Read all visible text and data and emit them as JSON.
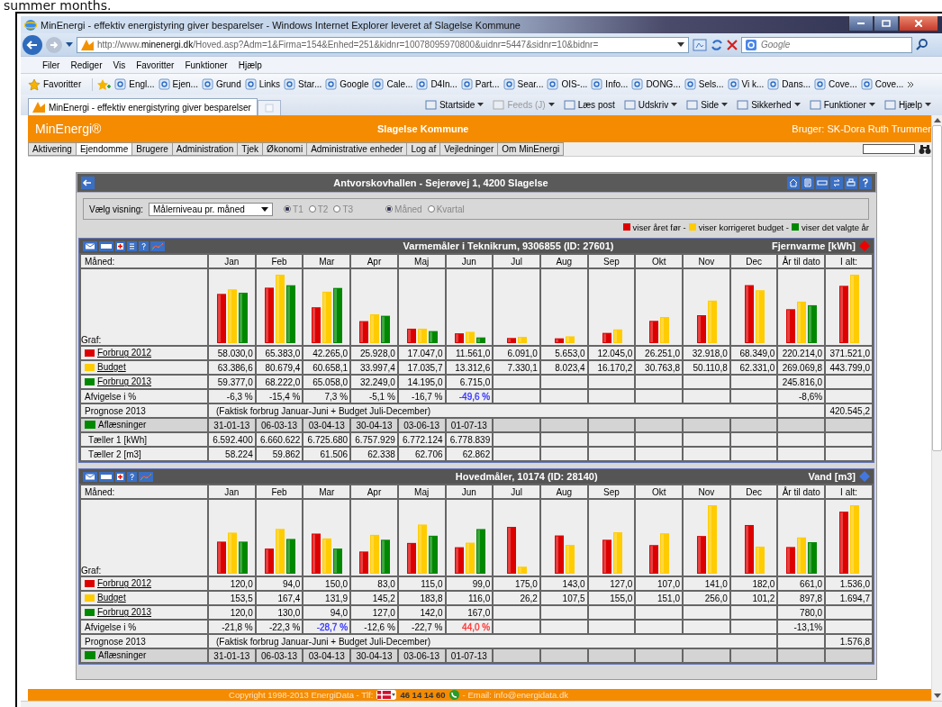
{
  "caption": "summer months.",
  "browser": {
    "title": "MinEnergi - effektiv energistyring giver besparelser - Windows Internet Explorer leveret af Slagelse Kommune",
    "address": "http://www.**minenergi.dk**/Hoved.asp?Adm=1&Firma=154&Enhed=251&kidnr=10078095970800&uidnr=5447&sidnr=10&bidnr=",
    "search_placeholder": "Google",
    "menu": [
      "Filer",
      "Rediger",
      "Vis",
      "Favoritter",
      "Funktioner",
      "Hjælp"
    ],
    "favorites_label": "Favoritter",
    "favorites": [
      "Engl...",
      "Ejen...",
      "Grund",
      "Links",
      "Star...",
      "Google",
      "Cale...",
      "D4In...",
      "Part...",
      "Sear...",
      "OIS-...",
      "Info...",
      "DONG...",
      "Sels...",
      "Vi k...",
      "Dans...",
      "Cove...",
      "Cove..."
    ],
    "tab": "MinEnergi - effektiv energistyring giver besparelser",
    "commands": [
      {
        "label": "Startside",
        "dropdown": true,
        "disabled": false
      },
      {
        "label": "Feeds (J)",
        "dropdown": true,
        "disabled": true
      },
      {
        "label": "Læs post",
        "dropdown": false,
        "disabled": false
      },
      {
        "label": "Udskriv",
        "dropdown": true,
        "disabled": false
      },
      {
        "label": "Side",
        "dropdown": true,
        "disabled": false
      },
      {
        "label": "Sikkerhed",
        "dropdown": true,
        "disabled": false
      },
      {
        "label": "Funktioner",
        "dropdown": true,
        "disabled": false
      },
      {
        "label": "Hjælp",
        "dropdown": true,
        "disabled": false
      }
    ]
  },
  "header": {
    "brand": "MinEnergi®",
    "organisation": "Slagelse Kommune",
    "user": "Bruger: SK-Dora Ruth Trummer"
  },
  "nav": [
    {
      "label": "Aktivering",
      "selected": false
    },
    {
      "label": "Ejendomme",
      "selected": true
    },
    {
      "label": "Brugere",
      "selected": false
    },
    {
      "label": "Administration",
      "selected": false
    },
    {
      "label": "Tjek",
      "selected": false
    },
    {
      "label": "Økonomi",
      "selected": false
    },
    {
      "label": "Administrative enheder",
      "selected": false
    },
    {
      "label": "Log af",
      "selected": false
    },
    {
      "label": "Vejledninger",
      "selected": false
    },
    {
      "label": "Om MinEnergi",
      "selected": false
    }
  ],
  "panel": {
    "title": "Antvorskovhallen - Sejerøvej 1, 4200 Slagelse",
    "view_label": "Vælg visning:",
    "view_value": "Målerniveau pr. måned",
    "tariffs": [
      {
        "label": "T1",
        "selected": true,
        "disabled": true
      },
      {
        "label": "T2",
        "selected": false,
        "disabled": true
      },
      {
        "label": "T3",
        "selected": false,
        "disabled": true
      }
    ],
    "periods": [
      {
        "label": "Måned",
        "selected": true,
        "disabled": true
      },
      {
        "label": "Kvartal",
        "selected": false,
        "disabled": true
      }
    ],
    "legend": [
      {
        "label": "viser året før -",
        "color": "#dd0000"
      },
      {
        "label": "viser korrigeret budget -",
        "color": "#ffcc00"
      },
      {
        "label": "viser det valgte år",
        "color": "#008800"
      }
    ]
  },
  "meters": [
    {
      "title": "Varmemåler i Teknikrum, 9306855 (ID: 27601)",
      "unit": "Fjernvarme [kWh]",
      "color": "#ee0000",
      "first_header": "Måned:",
      "graph_label": "Graf:",
      "columns": [
        "Jan",
        "Feb",
        "Mar",
        "Apr",
        "Maj",
        "Jun",
        "Jul",
        "Aug",
        "Sep",
        "Okt",
        "Nov",
        "Dec"
      ],
      "year_to_date_header": "År til dato",
      "total_header": "I alt:",
      "rows": [
        {
          "kind": "series",
          "label": "Forbrug 2012",
          "color": "#dd0000",
          "values": [
            "58.030,0",
            "65.383,0",
            "42.265,0",
            "25.928,0",
            "17.047,0",
            "11.561,0",
            "6.091,0",
            "5.653,0",
            "12.045,0",
            "26.251,0",
            "32.918,0",
            "68.349,0"
          ],
          "year_to_date": "220.214,0",
          "total": "371.521,0"
        },
        {
          "kind": "series",
          "label": "Budget",
          "color": "#ffcc00",
          "values": [
            "63.386,6",
            "80.679,4",
            "60.658,1",
            "33.997,4",
            "17.035,7",
            "13.312,6",
            "7.330,1",
            "8.023,4",
            "16.170,2",
            "30.763,8",
            "50.110,8",
            "62.331,0"
          ],
          "year_to_date": "269.069,8",
          "total": "443.799,0"
        },
        {
          "kind": "series",
          "label": "Forbrug 2013",
          "color": "#008800",
          "values": [
            "59.377,0",
            "68.222,0",
            "65.058,0",
            "32.249,0",
            "14.195,0",
            "6.715,0"
          ],
          "year_to_date": "245.816,0"
        },
        {
          "kind": "deviation",
          "label": "Afvigelse i %",
          "cells": [
            {
              "text": "-6,3 %"
            },
            {
              "text": "-15,4 %"
            },
            {
              "text": "7,3 %"
            },
            {
              "text": "-5,1 %"
            },
            {
              "text": "-16,7 %"
            },
            {
              "text": "-49,6 %",
              "color": "#3333ff"
            }
          ],
          "year_to_date": {
            "text": "-8,6%"
          }
        },
        {
          "kind": "forecast",
          "label": "Prognose 2013",
          "note": "(Faktisk forbrug Januar-Juni + Budget Juli-December)",
          "total": "420.545,2"
        },
        {
          "kind": "readings",
          "label": "Aflæsninger",
          "values": [
            "31-01-13",
            "06-03-13",
            "03-04-13",
            "30-04-13",
            "03-06-13",
            "01-07-13"
          ]
        },
        {
          "kind": "counter",
          "label": "Tæller 1 [kWh]",
          "values": [
            "6.592.400",
            "6.660.622",
            "6.725.680",
            "6.757.929",
            "6.772.124",
            "6.778.839"
          ]
        },
        {
          "kind": "counter",
          "label": "Tæller 2 [m3]",
          "values": [
            "58.224",
            "59.862",
            "61.506",
            "62.338",
            "62.706",
            "62.862"
          ]
        }
      ]
    },
    {
      "title": "Hovedmåler, 10174 (ID: 28140)",
      "unit": "Vand [m3]",
      "color": "#4477dd",
      "first_header": "Måned:",
      "graph_label": "Graf:",
      "columns": [
        "Jan",
        "Feb",
        "Mar",
        "Apr",
        "Maj",
        "Jun",
        "Jul",
        "Aug",
        "Sep",
        "Okt",
        "Nov",
        "Dec"
      ],
      "year_to_date_header": "År til dato",
      "total_header": "I alt:",
      "rows": [
        {
          "kind": "series",
          "label": "Forbrug 2012",
          "color": "#dd0000",
          "values": [
            "120,0",
            "94,0",
            "150,0",
            "83,0",
            "115,0",
            "99,0",
            "175,0",
            "143,0",
            "127,0",
            "107,0",
            "141,0",
            "182,0"
          ],
          "year_to_date": "661,0",
          "total": "1.536,0"
        },
        {
          "kind": "series",
          "label": "Budget",
          "color": "#ffcc00",
          "values": [
            "153,5",
            "167,4",
            "131,9",
            "145,2",
            "183,8",
            "116,0",
            "26,2",
            "107,5",
            "155,0",
            "151,0",
            "256,0",
            "101,2"
          ],
          "year_to_date": "897,8",
          "total": "1.694,7"
        },
        {
          "kind": "series",
          "label": "Forbrug 2013",
          "color": "#008800",
          "values": [
            "120,0",
            "130,0",
            "94,0",
            "127,0",
            "142,0",
            "167,0"
          ],
          "year_to_date": "780,0"
        },
        {
          "kind": "deviation",
          "label": "Afvigelse i %",
          "cells": [
            {
              "text": "-21,8 %"
            },
            {
              "text": "-22,3 %"
            },
            {
              "text": "-28,7 %",
              "color": "#3333ff"
            },
            {
              "text": "-12,6 %"
            },
            {
              "text": "-22,7 %"
            },
            {
              "text": "44,0 %",
              "color": "#ff3333"
            }
          ],
          "year_to_date": {
            "text": "-13,1%"
          }
        },
        {
          "kind": "forecast",
          "label": "Prognose 2013",
          "note": "(Faktisk forbrug Januar-Juni + Budget Juli-December)",
          "total": "1.576,8"
        },
        {
          "kind": "readings",
          "label": "Aflæsninger",
          "values": [
            "31-01-13",
            "06-03-13",
            "03-04-13",
            "30-04-13",
            "03-06-13",
            "01-07-13"
          ]
        }
      ]
    }
  ],
  "footer": {
    "copyright": "Copyright 1998-2013 EnergiData - Tlf:",
    "phone": "46 14 14 60",
    "email": "- Email: info@energidata.dk"
  }
}
